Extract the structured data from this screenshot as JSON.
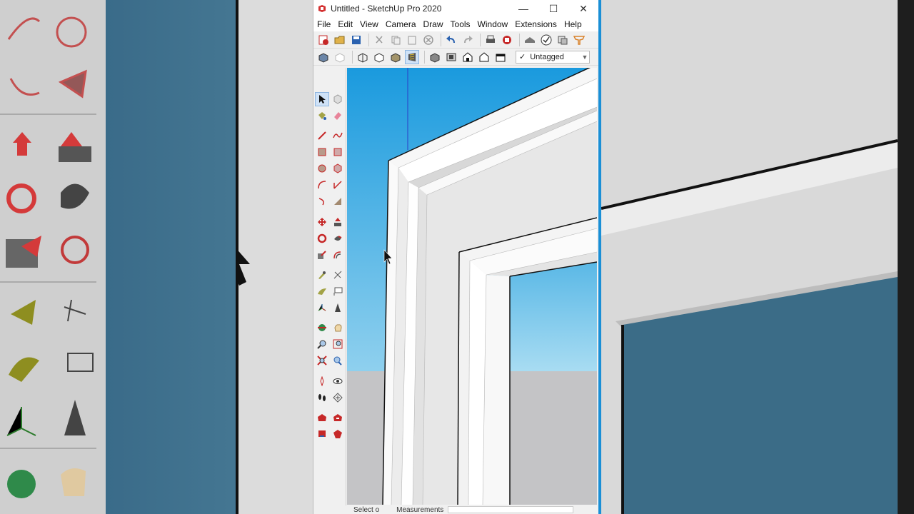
{
  "window": {
    "title": "Untitled - SketchUp Pro 2020",
    "controls": {
      "minimize": "—",
      "maximize": "☐",
      "close": "✕"
    }
  },
  "menu": [
    "File",
    "Edit",
    "View",
    "Camera",
    "Draw",
    "Tools",
    "Window",
    "Extensions",
    "Help"
  ],
  "toolbar1_icons": [
    "new-icon",
    "open-icon",
    "save-icon",
    "cut-icon",
    "copy-icon",
    "paste-icon",
    "erase-icon",
    "undo-icon",
    "redo-icon",
    "print-icon",
    "model-info-icon",
    "warehouse-icon",
    "extension-check-icon",
    "layout-icon",
    "extension-warehouse-icon"
  ],
  "toolbar2_icons": [
    "xray-icon",
    "backedges-icon",
    "wireframe-icon",
    "hiddenline-icon",
    "shaded-icon",
    "textured-icon",
    "iso-icon",
    "top-view-icon",
    "front-view-icon",
    "right-view-icon",
    "back-view-icon",
    "left-view-icon"
  ],
  "tag": {
    "check": "✓",
    "name": "Untagged"
  },
  "palette": [
    "select-icon",
    "component-icon",
    "paint-bucket-icon",
    "eraser-icon",
    "line-icon",
    "freehand-icon",
    "rectangle-icon",
    "rotated-rectangle-icon",
    "circle-icon",
    "polygon-icon",
    "arc-icon",
    "pie-icon",
    "3pt-arc-icon",
    "2pt-arc-icon",
    "move-icon",
    "push-pull-icon",
    "rotate-icon",
    "follow-me-icon",
    "scale-icon",
    "offset-icon",
    "tape-measure-icon",
    "dimension-icon",
    "protractor-icon",
    "text-icon",
    "axes-icon",
    "3d-text-icon",
    "orbit-icon",
    "pan-icon",
    "zoom-icon",
    "zoom-window-icon",
    "zoom-extents-icon",
    "previous-view-icon",
    "position-camera-icon",
    "look-around-icon",
    "walk-icon",
    "section-plane-icon",
    "warehouse-icon-1",
    "share-model-icon",
    "share-component-icon",
    "extension-warehouse-icon-2"
  ],
  "status": {
    "select_hint": "Select o",
    "measurements_label": "Measurements"
  }
}
